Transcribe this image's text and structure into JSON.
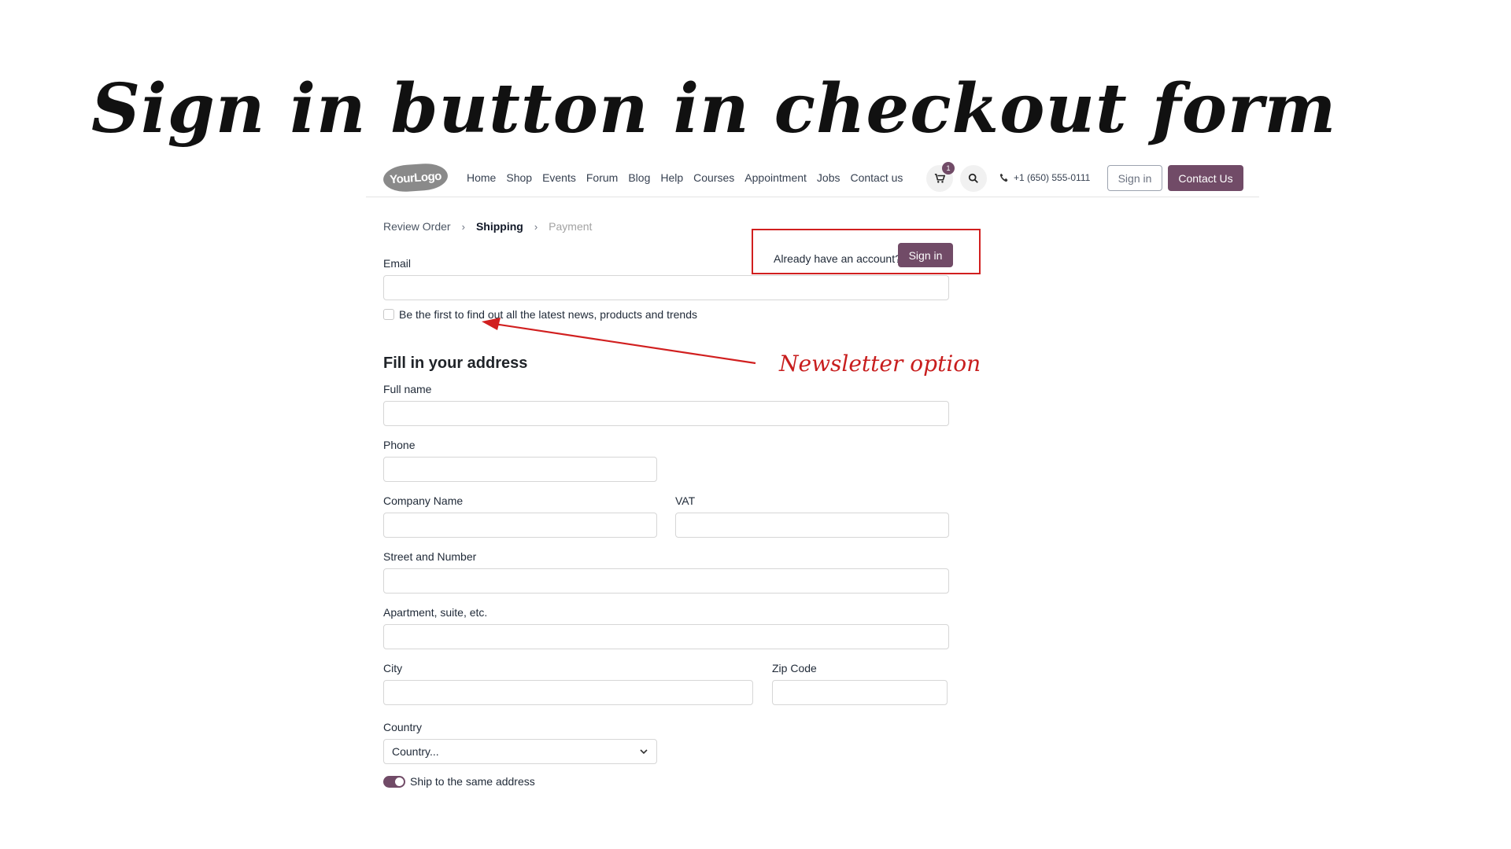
{
  "slide": {
    "title": "Sign in button in checkout form"
  },
  "navbar": {
    "logo_text": "YourLogo",
    "links": [
      "Home",
      "Shop",
      "Events",
      "Forum",
      "Blog",
      "Help",
      "Courses",
      "Appointment",
      "Jobs",
      "Contact us"
    ],
    "cart_count": "1",
    "phone": "+1 (650) 555-0111",
    "sign_in_label": "Sign in",
    "contact_label": "Contact Us"
  },
  "breadcrumb": {
    "step1": "Review Order",
    "step2": "Shipping",
    "step3": "Payment"
  },
  "signin_prompt": {
    "text": "Already have an account?",
    "button": "Sign in"
  },
  "form": {
    "email_label": "Email",
    "newsletter_label": "Be the first to find out all the latest news, products and trends",
    "address_heading": "Fill in your address",
    "full_name_label": "Full name",
    "phone_label": "Phone",
    "company_label": "Company Name",
    "vat_label": "VAT",
    "street_label": "Street and Number",
    "apartment_label": "Apartment, suite, etc.",
    "city_label": "City",
    "zip_label": "Zip Code",
    "country_label": "Country",
    "country_value": "Country...",
    "ship_same_label": "Ship to the same address"
  },
  "annotation": {
    "newsletter": "Newsletter option"
  },
  "colors": {
    "brand": "#714b67",
    "annotation_red": "#d11f1f"
  }
}
